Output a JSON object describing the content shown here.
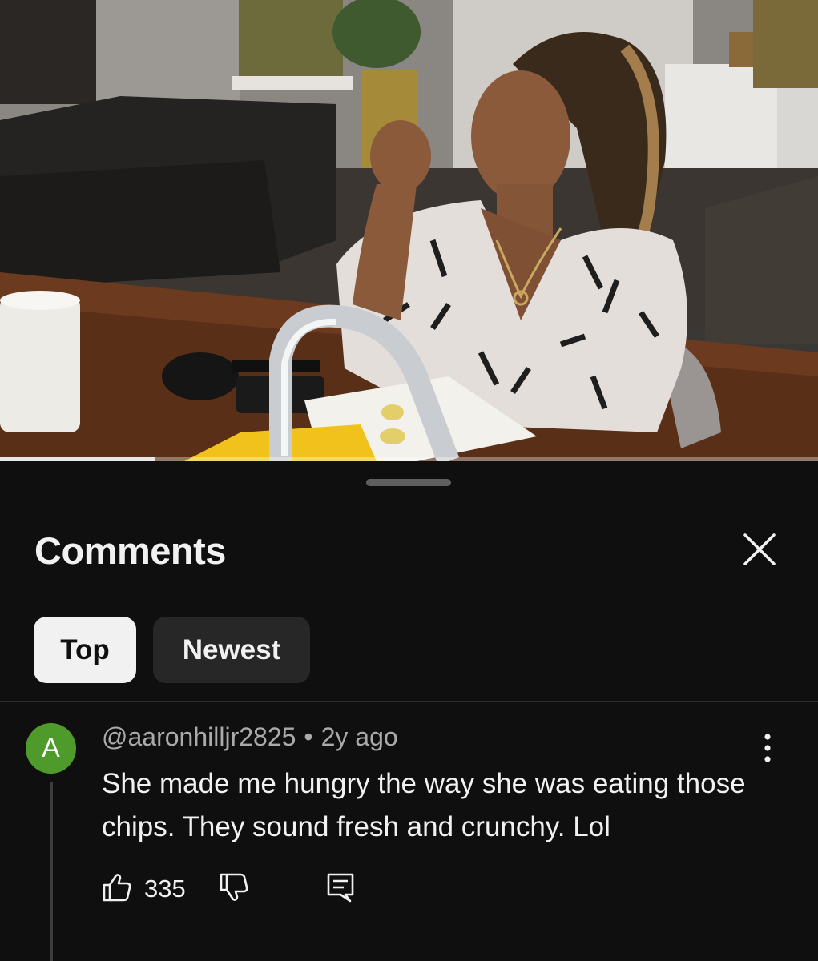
{
  "video": {
    "progress_fraction": 0.19
  },
  "comments_panel": {
    "title": "Comments",
    "close_icon": "close-icon",
    "filters": [
      {
        "label": "Top",
        "selected": true
      },
      {
        "label": "Newest",
        "selected": false
      }
    ]
  },
  "comment": {
    "avatar_letter": "A",
    "avatar_color": "#4e9b2c",
    "author": "@aaronhilljr2825",
    "separator": "•",
    "time": "2y ago",
    "text": "She made me hungry the way she was eating those chips. They sound fresh and crunchy. Lol",
    "like_count": "335",
    "icons": {
      "like": "thumbs-up-icon",
      "dislike": "thumbs-down-icon",
      "reply": "reply-comment-icon",
      "more": "more-vertical-icon"
    }
  },
  "colors": {
    "background": "#0f0f0f",
    "chip_selected": "#f1f1f1",
    "chip_unselected": "#272727",
    "text_primary": "#f1f1f1",
    "text_secondary": "#aaaaaa"
  }
}
